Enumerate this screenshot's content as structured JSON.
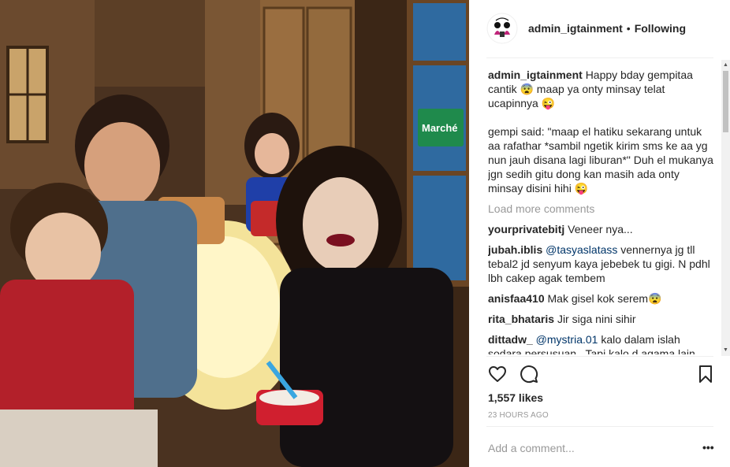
{
  "post": {
    "username": "admin_igtainment",
    "separator": "•",
    "follow_status": "Following"
  },
  "photo": {
    "description_icon": "photo-of-family-at-birthday",
    "sign_text": "Marché"
  },
  "caption": {
    "username": "admin_igtainment",
    "line1": "Happy bday gempitaa cantik 😨 maap ya onty minsay telat ucapinnya 😜",
    "line2": "gempi said: \"maap el hatiku sekarang untuk aa rafathar *sambil ngetik kirim sms ke aa yg nun jauh disana lagi liburan*\" Duh el mukanya jgn sedih gitu dong kan masih ada onty minsay disini hihi 😜"
  },
  "load_more": "Load more comments",
  "comments": [
    {
      "user": "yourprivatebitj",
      "mention": "",
      "text": "Veneer nya..."
    },
    {
      "user": "jubah.iblis",
      "mention": "@tasyaslatass",
      "text": "vennernya jg tll tebal2 jd senyum kaya jebebek tu gigi. N pdhl lbh cakep agak tembem"
    },
    {
      "user": "anisfaa410",
      "mention": "",
      "text": "Mak gisel kok serem😨"
    },
    {
      "user": "rita_bhataris",
      "mention": "",
      "text": "Jir siga nini sihir"
    },
    {
      "user": "dittadw_",
      "mention": "@mystria.01",
      "text": "kalo dalam islah sodara persusuan . Tapi kalo d agama lain"
    }
  ],
  "actions": {
    "like_icon": "heart-icon",
    "comment_icon": "comment-icon",
    "save_icon": "bookmark-icon"
  },
  "likes": "1,557 likes",
  "time": "23 HOURS AGO",
  "add_comment_placeholder": "Add a comment...",
  "more_options": "•••",
  "colors": {
    "text": "#262626",
    "muted": "#999999",
    "mention": "#003569",
    "divider": "#efefef"
  }
}
